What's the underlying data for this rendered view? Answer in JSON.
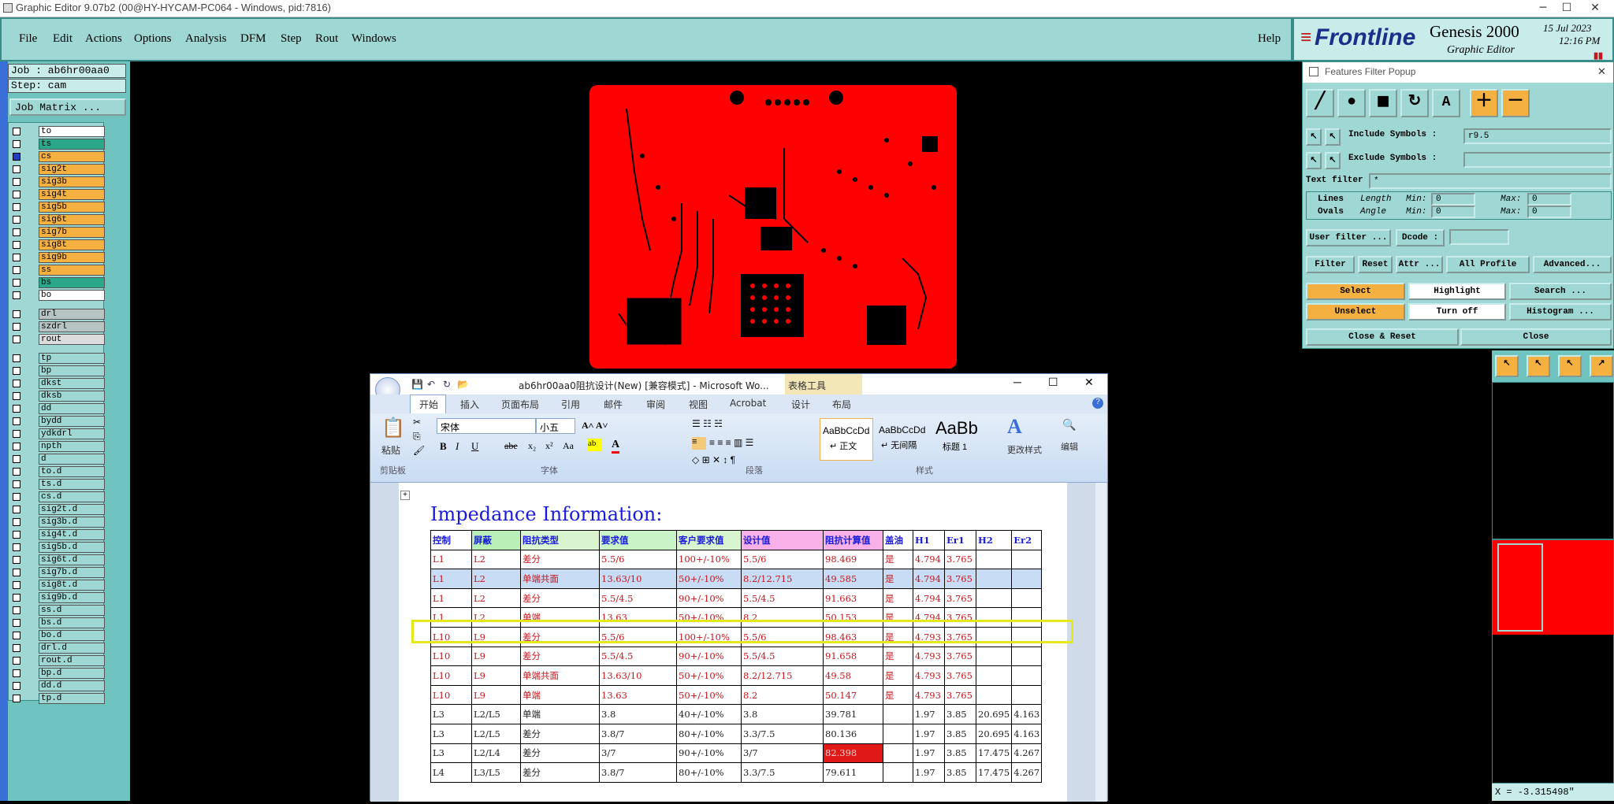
{
  "titlebar": {
    "title": "Graphic Editor 9.07b2 (00@HY-HYCAM-PC064 - Windows, pid:7816)"
  },
  "menu": {
    "items": [
      "File",
      "Edit",
      "Actions",
      "Options",
      "Analysis",
      "DFM",
      "Step",
      "Rout",
      "Windows"
    ],
    "help": "Help"
  },
  "brand": {
    "logo": "Frontline",
    "product": "Genesis 2000",
    "sub": "Graphic Editor",
    "date": "15 Jul 2023",
    "time": "12:16 PM"
  },
  "job": {
    "job": "Job : ab6hr00aa0",
    "step": "Step: cam",
    "matrix_button": "Job Matrix ..."
  },
  "layers": [
    {
      "name": "to",
      "color": "#ffffff",
      "checked": false
    },
    {
      "name": "ts",
      "color": "#2aa889",
      "checked": false
    },
    {
      "name": "cs",
      "color": "#f5b042",
      "checked": true,
      "active": true
    },
    {
      "name": "sig2t",
      "color": "#f5b042",
      "checked": false
    },
    {
      "name": "sig3b",
      "color": "#f5b042",
      "checked": false
    },
    {
      "name": "sig4t",
      "color": "#f5b042",
      "checked": false
    },
    {
      "name": "sig5b",
      "color": "#f5b042",
      "checked": false
    },
    {
      "name": "sig6t",
      "color": "#f5b042",
      "checked": false
    },
    {
      "name": "sig7b",
      "color": "#f5b042",
      "checked": false
    },
    {
      "name": "sig8t",
      "color": "#f5b042",
      "checked": false
    },
    {
      "name": "sig9b",
      "color": "#f5b042",
      "checked": false
    },
    {
      "name": "ss",
      "color": "#f5b042",
      "checked": false
    },
    {
      "name": "bs",
      "color": "#2aa889",
      "checked": false
    },
    {
      "name": "bo",
      "color": "#ffffff",
      "checked": false
    },
    {
      "name": "drl",
      "color": "#b8c4c4",
      "checked": false,
      "gap": true
    },
    {
      "name": "szdrl",
      "color": "#b8c4c4",
      "checked": false
    },
    {
      "name": "rout",
      "color": "#dcdcdc",
      "checked": false
    },
    {
      "name": "tp",
      "color": "#9ed7d4",
      "checked": false,
      "gap": true
    },
    {
      "name": "bp",
      "color": "#9ed7d4",
      "checked": false
    },
    {
      "name": "dkst",
      "color": "#9ed7d4",
      "checked": false
    },
    {
      "name": "dksb",
      "color": "#9ed7d4",
      "checked": false
    },
    {
      "name": "dd",
      "color": "#9ed7d4",
      "checked": false
    },
    {
      "name": "bydd",
      "color": "#9ed7d4",
      "checked": false
    },
    {
      "name": "ydkdrl",
      "color": "#9ed7d4",
      "checked": false
    },
    {
      "name": "npth",
      "color": "#9ed7d4",
      "checked": false
    },
    {
      "name": "d",
      "color": "#9ed7d4",
      "checked": false
    },
    {
      "name": "to.d",
      "color": "#9ed7d4",
      "checked": false
    },
    {
      "name": "ts.d",
      "color": "#9ed7d4",
      "checked": false
    },
    {
      "name": "cs.d",
      "color": "#9ed7d4",
      "checked": false
    },
    {
      "name": "sig2t.d",
      "color": "#9ed7d4",
      "checked": false
    },
    {
      "name": "sig3b.d",
      "color": "#9ed7d4",
      "checked": false
    },
    {
      "name": "sig4t.d",
      "color": "#9ed7d4",
      "checked": false
    },
    {
      "name": "sig5b.d",
      "color": "#9ed7d4",
      "checked": false
    },
    {
      "name": "sig6t.d",
      "color": "#9ed7d4",
      "checked": false
    },
    {
      "name": "sig7b.d",
      "color": "#9ed7d4",
      "checked": false
    },
    {
      "name": "sig8t.d",
      "color": "#9ed7d4",
      "checked": false
    },
    {
      "name": "sig9b.d",
      "color": "#9ed7d4",
      "checked": false
    },
    {
      "name": "ss.d",
      "color": "#9ed7d4",
      "checked": false
    },
    {
      "name": "bs.d",
      "color": "#9ed7d4",
      "checked": false
    },
    {
      "name": "bo.d",
      "color": "#9ed7d4",
      "checked": false
    },
    {
      "name": "drl.d",
      "color": "#9ed7d4",
      "checked": false
    },
    {
      "name": "rout.d",
      "color": "#9ed7d4",
      "checked": false
    },
    {
      "name": "bp.d",
      "color": "#9ed7d4",
      "checked": false
    },
    {
      "name": "dd.d",
      "color": "#9ed7d4",
      "checked": false
    },
    {
      "name": "tp.d",
      "color": "#9ed7d4",
      "checked": false
    }
  ],
  "filter": {
    "title": "Features Filter Popup",
    "include_label": "Include Symbols :",
    "include_value": "r9.5",
    "exclude_label": "Exclude Symbols :",
    "exclude_value": "",
    "text_filter_label": "Text filter",
    "text_filter_value": "*",
    "lines": "Lines",
    "ovals": "Ovals",
    "length": "Length",
    "angle": "Angle",
    "min": "Min:",
    "max": "Max:",
    "min_v1": "0",
    "max_v1": "0",
    "min_v2": "0",
    "max_v2": "0",
    "user_filter": "User filter ...",
    "dcode": "Dcode :",
    "filter_btn": "Filter",
    "reset": "Reset",
    "attr": "Attr ...",
    "all_profile": "All Profile",
    "advanced": "Advanced...",
    "select": "Select",
    "highlight": "Highlight",
    "search": "Search ...",
    "unselect": "Unselect",
    "turn_off": "Turn off",
    "histogram": "Histogram ...",
    "close_reset": "Close & Reset",
    "close": "Close"
  },
  "word": {
    "title": "ab6hr00aa0阻抗设计(New) [兼容模式] - Microsoft Wo...",
    "context_tab": "表格工具",
    "tabs": [
      "开始",
      "插入",
      "页面布局",
      "引用",
      "邮件",
      "审阅",
      "视图",
      "Acrobat",
      "设计",
      "布局"
    ],
    "font_name": "宋体",
    "font_size": "小五",
    "paste": "粘贴",
    "clipboard": "剪贴板",
    "font_group": "字体",
    "para_group": "段落",
    "style_group": "样式",
    "styles": [
      {
        "sample": "AaBbCcDd",
        "name": "↵ 正文"
      },
      {
        "sample": "AaBbCcDd",
        "name": "↵ 无间隔"
      },
      {
        "sample": "AaBb",
        "name": "标题 1"
      }
    ],
    "change_style": "更改样式",
    "edit": "编辑",
    "doc_heading": "Impedance Information:"
  },
  "impedance_table": {
    "headers": [
      "控制",
      "屏蔽",
      "阻抗类型",
      "要求值",
      "客户要求值",
      "设计值",
      "阻抗计算值",
      "盖油",
      "H1",
      "Er1",
      "H2",
      "Er2"
    ],
    "rows": [
      [
        "L1",
        "L2",
        "差分",
        "5.5/6",
        "100+/-10%",
        "5.5/6",
        "98.469",
        "是",
        "4.794",
        "3.765",
        "",
        ""
      ],
      [
        "L1",
        "L2",
        "单端共面",
        "13.63/10",
        "50+/-10%",
        "8.2/12.715",
        "49.585",
        "是",
        "4.794",
        "3.765",
        "",
        ""
      ],
      [
        "L1",
        "L2",
        "差分",
        "5.5/4.5",
        "90+/-10%",
        "5.5/4.5",
        "91.663",
        "是",
        "4.794",
        "3.765",
        "",
        ""
      ],
      [
        "L1",
        "L2",
        "单端",
        "13.63",
        "50+/-10%",
        "8.2",
        "50.153",
        "是",
        "4.794",
        "3.765",
        "",
        ""
      ],
      [
        "L10",
        "L9",
        "差分",
        "5.5/6",
        "100+/-10%",
        "5.5/6",
        "98.463",
        "是",
        "4.793",
        "3.765",
        "",
        ""
      ],
      [
        "L10",
        "L9",
        "差分",
        "5.5/4.5",
        "90+/-10%",
        "5.5/4.5",
        "91.658",
        "是",
        "4.793",
        "3.765",
        "",
        ""
      ],
      [
        "L10",
        "L9",
        "单端共面",
        "13.63/10",
        "50+/-10%",
        "8.2/12.715",
        "49.58",
        "是",
        "4.793",
        "3.765",
        "",
        ""
      ],
      [
        "L10",
        "L9",
        "单端",
        "13.63",
        "50+/-10%",
        "8.2",
        "50.147",
        "是",
        "4.793",
        "3.765",
        "",
        ""
      ],
      [
        "L3",
        "L2/L5",
        "单端",
        "3.8",
        "40+/-10%",
        "3.8",
        "39.781",
        "",
        "1.97",
        "3.85",
        "20.695",
        "4.163"
      ],
      [
        "L3",
        "L2/L5",
        "差分",
        "3.8/7",
        "80+/-10%",
        "3.3/7.5",
        "80.136",
        "",
        "1.97",
        "3.85",
        "20.695",
        "4.163"
      ],
      [
        "L3",
        "L2/L4",
        "差分",
        "3/7",
        "90+/-10%",
        "3/7",
        "82.398",
        "",
        "1.97",
        "3.85",
        "17.475",
        "4.267"
      ],
      [
        "L4",
        "L3/L5",
        "差分",
        "3.8/7",
        "80+/-10%",
        "3.3/7.5",
        "79.611",
        "",
        "1.97",
        "3.85",
        "17.475",
        "4.267"
      ]
    ]
  },
  "status": {
    "coord": "X = -3.315498\""
  }
}
